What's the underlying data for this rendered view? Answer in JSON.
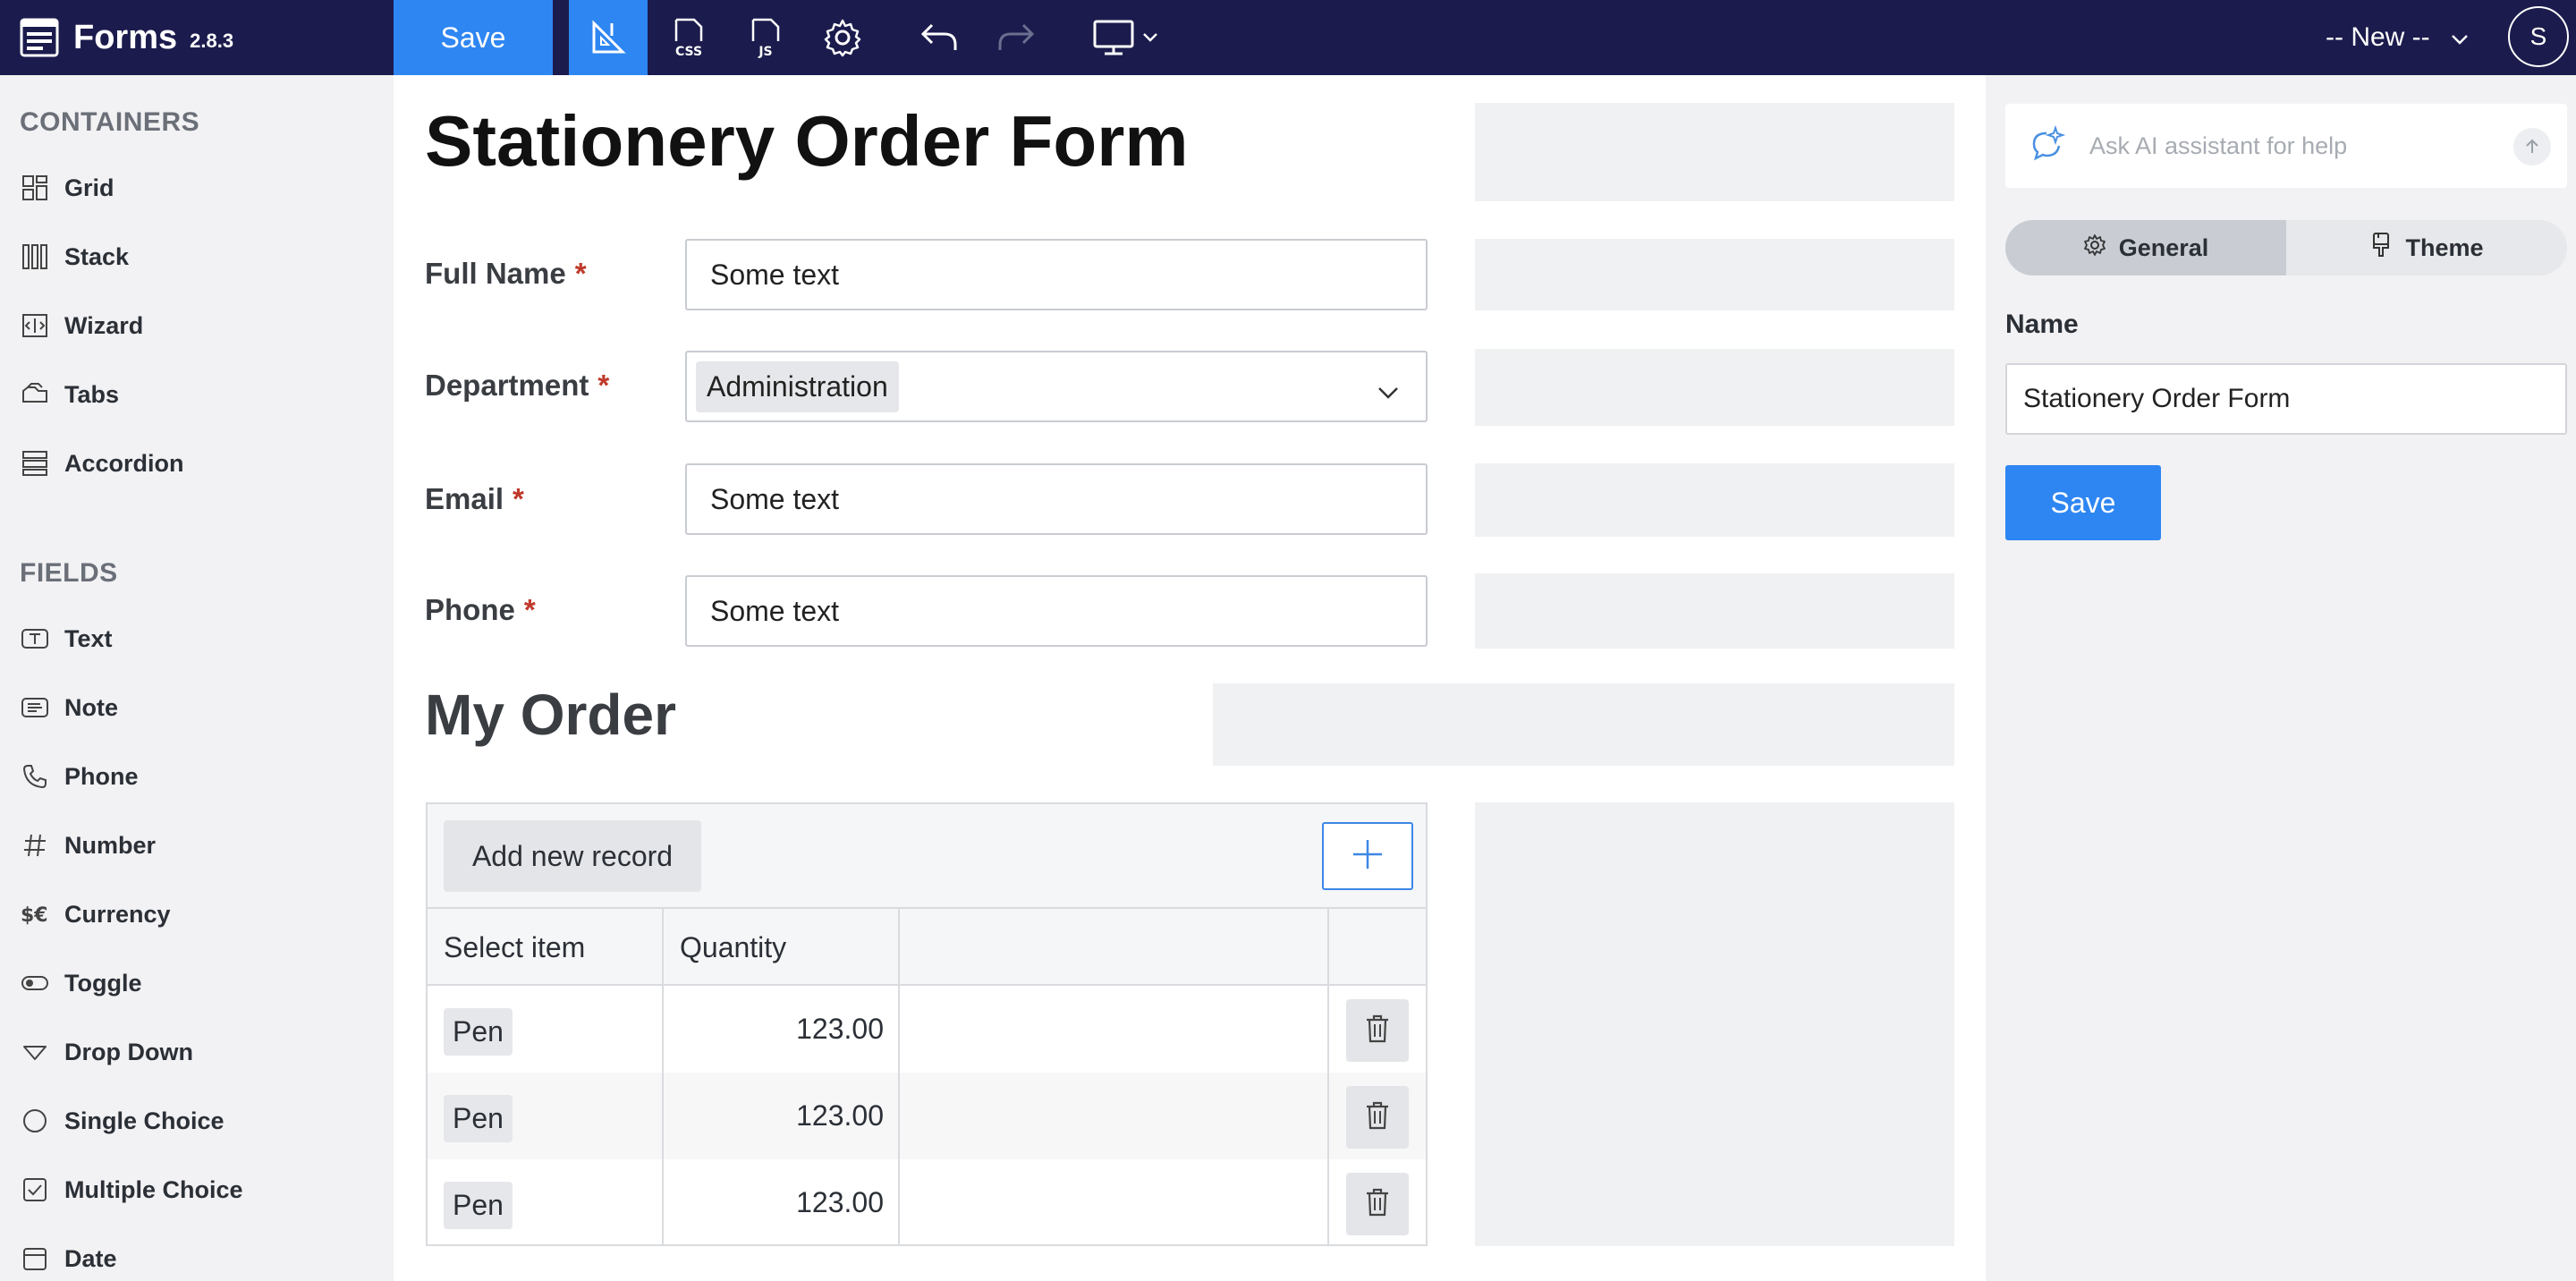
{
  "app": {
    "name": "Forms",
    "version": "2.8.3"
  },
  "toolbar": {
    "save_label": "Save",
    "layout_select": "-- New --",
    "avatar_initial": "S",
    "icons": [
      "designer-icon",
      "css-icon",
      "js-icon",
      "gear-icon",
      "undo-icon",
      "redo-icon",
      "monitor-icon"
    ]
  },
  "sidebar": {
    "containers_heading": "CONTAINERS",
    "containers": [
      {
        "label": "Grid",
        "icon": "grid-icon"
      },
      {
        "label": "Stack",
        "icon": "stack-icon"
      },
      {
        "label": "Wizard",
        "icon": "wizard-icon"
      },
      {
        "label": "Tabs",
        "icon": "tabs-icon"
      },
      {
        "label": "Accordion",
        "icon": "accordion-icon"
      }
    ],
    "fields_heading": "FIELDS",
    "fields": [
      {
        "label": "Text",
        "icon": "text-icon"
      },
      {
        "label": "Note",
        "icon": "note-icon"
      },
      {
        "label": "Phone",
        "icon": "phone-icon"
      },
      {
        "label": "Number",
        "icon": "hash-icon"
      },
      {
        "label": "Currency",
        "icon": "currency-icon"
      },
      {
        "label": "Toggle",
        "icon": "toggle-icon"
      },
      {
        "label": "Drop Down",
        "icon": "dropdown-icon"
      },
      {
        "label": "Single Choice",
        "icon": "radio-icon"
      },
      {
        "label": "Multiple Choice",
        "icon": "checkbox-icon"
      },
      {
        "label": "Date",
        "icon": "calendar-icon"
      }
    ]
  },
  "form": {
    "title": "Stationery Order Form",
    "required_mark": "*",
    "fields": {
      "full_name": {
        "label": "Full Name",
        "value": "Some text"
      },
      "department": {
        "label": "Department",
        "value": "Administration"
      },
      "email": {
        "label": "Email",
        "value": "Some text"
      },
      "phone": {
        "label": "Phone",
        "value": "Some text"
      }
    },
    "section_title": "My Order",
    "table": {
      "add_label": "Add new record",
      "columns": [
        "Select item",
        "Quantity"
      ],
      "rows": [
        {
          "item": "Pen",
          "quantity": "123.00"
        },
        {
          "item": "Pen",
          "quantity": "123.00"
        },
        {
          "item": "Pen",
          "quantity": "123.00"
        }
      ]
    }
  },
  "right_panel": {
    "ai_placeholder": "Ask AI assistant for help",
    "tabs": {
      "general": "General",
      "theme": "Theme"
    },
    "name_label": "Name",
    "name_value": "Stationery Order Form",
    "save_label": "Save"
  },
  "colors": {
    "topbar": "#1b1b4d",
    "accent": "#2e86f2",
    "required": "#c0392b"
  }
}
